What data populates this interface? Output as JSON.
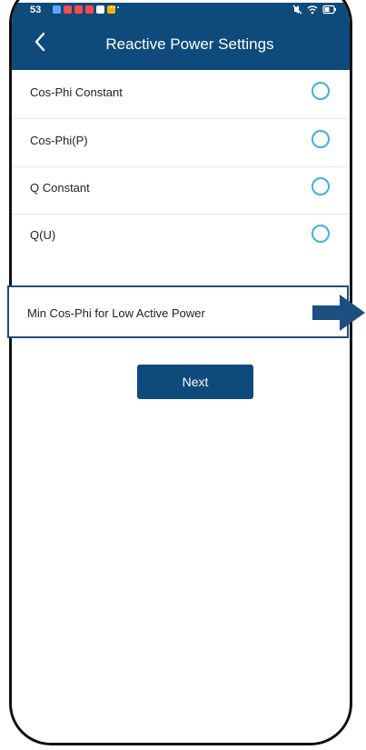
{
  "status_bar": {
    "time": "53",
    "notification_colors": [
      "#5aa7ff",
      "#ff4a4a",
      "#ff4a4a",
      "#ff4a4a",
      "#ffffff",
      "#ffb400"
    ],
    "more": "···",
    "icons": [
      "mute-icon",
      "wifi-icon",
      "battery-icon"
    ]
  },
  "header": {
    "title": "Reactive Power Settings",
    "back_icon": "chevron-left-icon"
  },
  "options": [
    {
      "label": "Cos-Phi Constant"
    },
    {
      "label": "Cos-Phi(P)"
    },
    {
      "label": "Q Constant"
    },
    {
      "label": "Q(U)"
    }
  ],
  "highlighted_option": {
    "label": "Min Cos-Phi for Low Active Power"
  },
  "next_button": {
    "label": "Next"
  },
  "colors": {
    "primary": "#0f4a7c",
    "radio": "#3fb0d8",
    "highlight_border": "#1d4e82"
  }
}
